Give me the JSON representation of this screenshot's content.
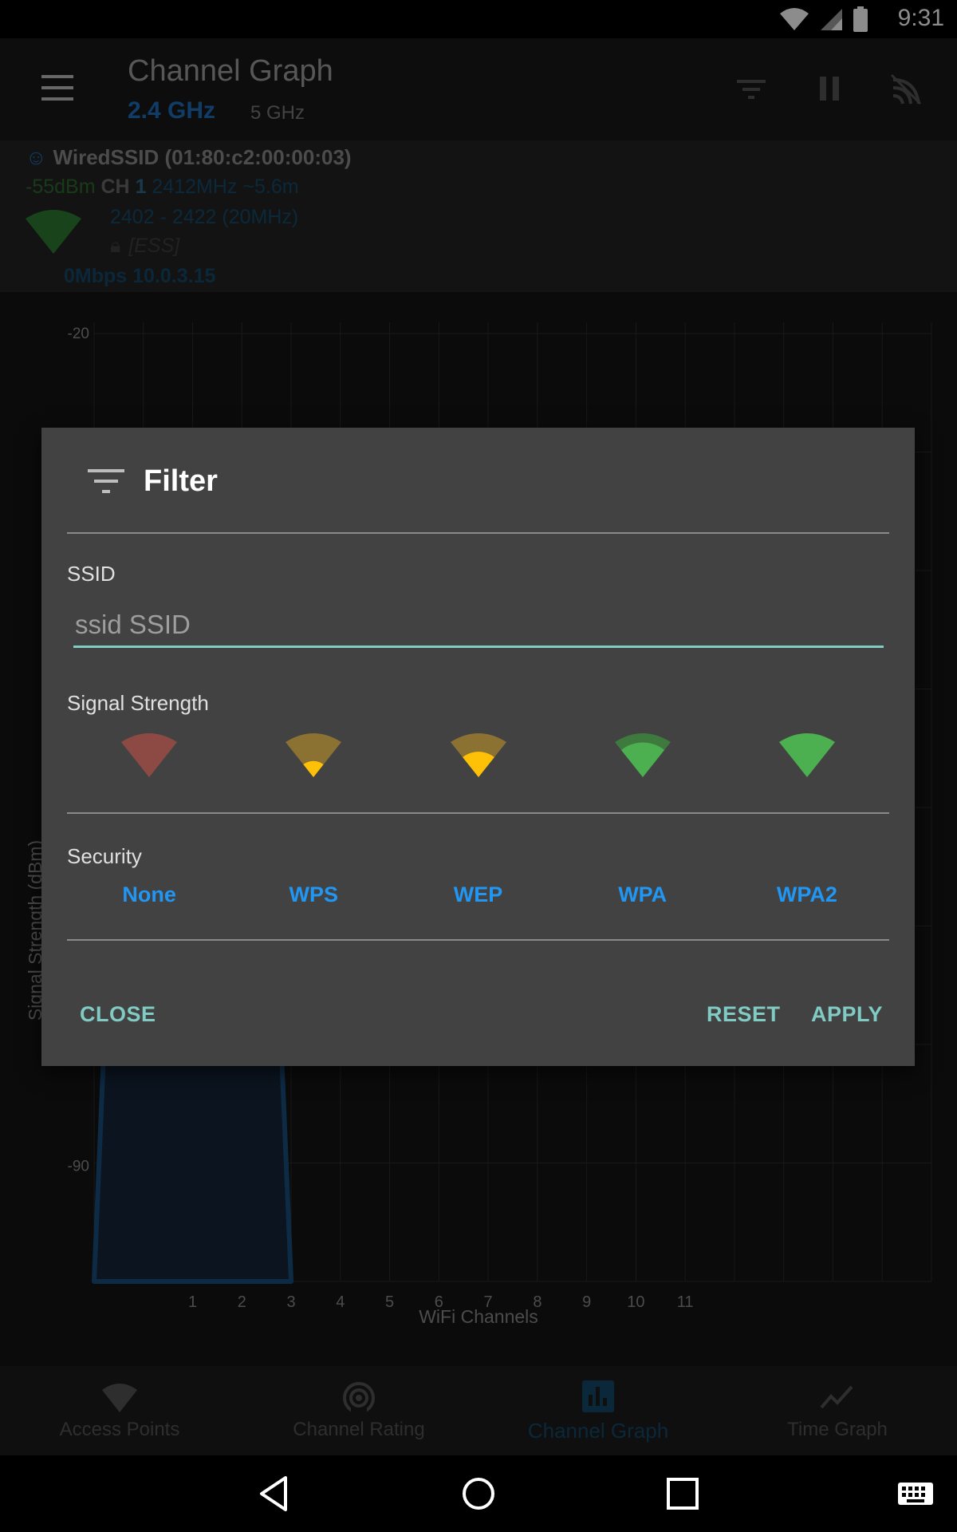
{
  "status_bar": {
    "time": "9:31"
  },
  "app_bar": {
    "title": "Channel Graph",
    "band_active": "2.4 GHz",
    "band_inactive": "5 GHz"
  },
  "ap_info": {
    "ssid_line": "WiredSSID (01:80:c2:00:00:03)",
    "signal": "-55dBm",
    "ch_label": "CH",
    "channel": "1",
    "frequency": "2412MHz",
    "distance": "~5.6m",
    "range": "2402 - 2422 (20MHz)",
    "capabilities": "[ESS]",
    "speed_ip": "0Mbps 10.0.3.15"
  },
  "chart_data": {
    "type": "area",
    "xlabel": "WiFi Channels",
    "ylabel": "Signal Strength (dBm)",
    "x_ticks": [
      "1",
      "2",
      "3",
      "4",
      "5",
      "6",
      "7",
      "8",
      "9",
      "10",
      "11"
    ],
    "y_ticks_visible": [
      "-20",
      "-90"
    ],
    "series": [
      {
        "name": "WiredSSID",
        "channel": 1,
        "range_channels": [
          -1,
          3
        ],
        "signal_dbm": -55
      }
    ],
    "colors": {
      "series": "#1a4f7e",
      "grid": "#2e2e2e"
    }
  },
  "dialog": {
    "title": "Filter",
    "ssid_label": "SSID",
    "ssid_placeholder": "ssid SSID",
    "signal_label": "Signal Strength",
    "signal_levels": [
      {
        "name": "level-0",
        "outer": "#8d4a45",
        "inner": "#8d4a45",
        "fill": 0.0
      },
      {
        "name": "level-1",
        "outer": "#8c7232",
        "inner": "#ffc107",
        "fill": 0.35
      },
      {
        "name": "level-2",
        "outer": "#8c7232",
        "inner": "#ffc107",
        "fill": 0.55
      },
      {
        "name": "level-3",
        "outer": "#3e7a3e",
        "inner": "#4caf50",
        "fill": 0.75
      },
      {
        "name": "level-4",
        "outer": "#4caf50",
        "inner": "#4caf50",
        "fill": 1.0
      }
    ],
    "security_label": "Security",
    "security_options": [
      "None",
      "WPS",
      "WEP",
      "WPA",
      "WPA2"
    ],
    "close_label": "CLOSE",
    "reset_label": "RESET",
    "apply_label": "APPLY"
  },
  "bottom_nav": {
    "items": [
      {
        "label": "Access Points",
        "icon": "wifi-icon",
        "active": false
      },
      {
        "label": "Channel Rating",
        "icon": "radar-icon",
        "active": false
      },
      {
        "label": "Channel Graph",
        "icon": "bar-chart-icon",
        "active": true
      },
      {
        "label": "Time Graph",
        "icon": "line-chart-icon",
        "active": false
      }
    ]
  }
}
